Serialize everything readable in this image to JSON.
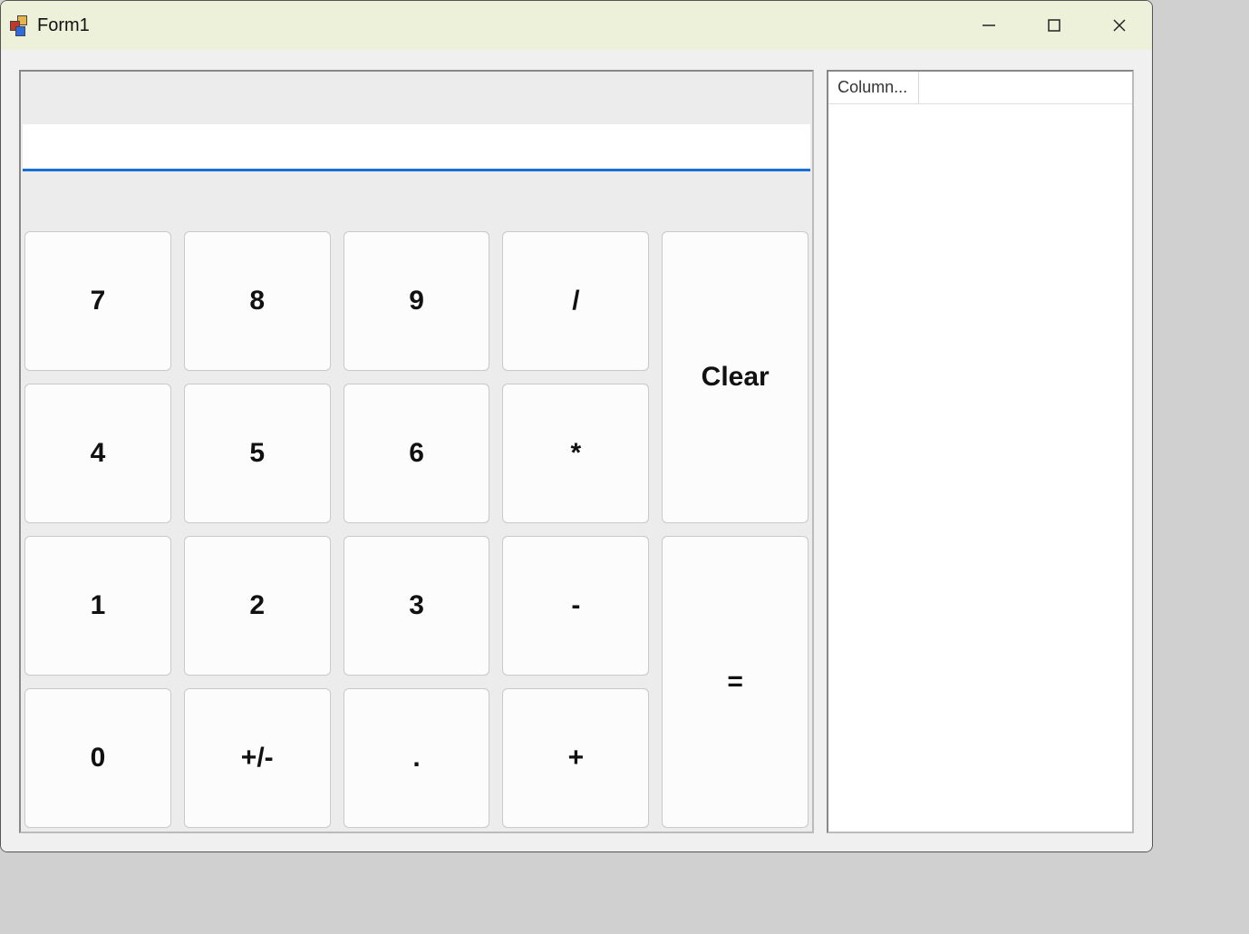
{
  "window": {
    "title": "Form1"
  },
  "display": {
    "value": ""
  },
  "keys": {
    "k7": "7",
    "k8": "8",
    "k9": "9",
    "div": "/",
    "clear": "Clear",
    "k4": "4",
    "k5": "5",
    "k6": "6",
    "mul": "*",
    "k1": "1",
    "k2": "2",
    "k3": "3",
    "sub": "-",
    "eq": "=",
    "k0": "0",
    "neg": "+/-",
    "dot": ".",
    "add": "+"
  },
  "list": {
    "column_header": "Column...",
    "rows": []
  }
}
